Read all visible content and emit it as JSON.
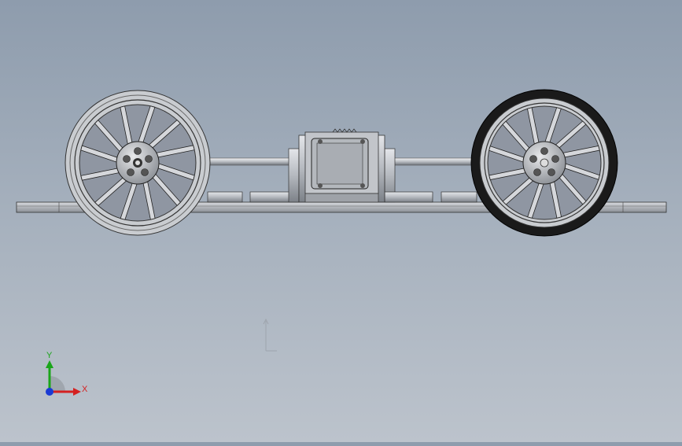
{
  "viewport": {
    "view": "Front",
    "triad": {
      "y_label": "Y",
      "x_label": "X",
      "y_color": "#1aa51a",
      "x_color": "#d42020",
      "z_color": "#1a3ad4"
    }
  },
  "model": {
    "part_color": "#b8bcc2",
    "edge_color": "#2a2a2a",
    "tire_color": "#1a1a1a",
    "left_wheel": {
      "tire": "light-grey",
      "spokes": 12,
      "bolt_holes": 5
    },
    "right_wheel": {
      "tire": "black",
      "spokes": 12,
      "bolt_holes": 5
    }
  }
}
